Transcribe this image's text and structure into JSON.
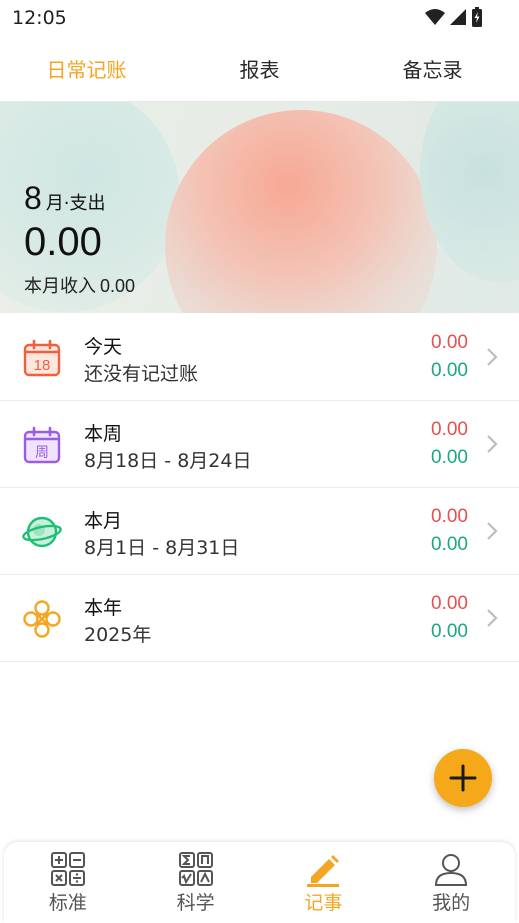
{
  "status_bar": {
    "time": "12:05"
  },
  "top_tabs": [
    {
      "label": "日常记账",
      "active": true
    },
    {
      "label": "报表",
      "active": false
    },
    {
      "label": "备忘录",
      "active": false
    }
  ],
  "banner": {
    "month_number": "8",
    "month_suffix": "月·支出",
    "expense": "0.00",
    "income_label": "本月收入",
    "income_value": "0.00"
  },
  "rows": [
    {
      "title": "今天",
      "subtitle": "还没有记过账",
      "expense": "0.00",
      "income": "0.00",
      "icon": "calendar-18-icon",
      "icon_text": "18"
    },
    {
      "title": "本周",
      "subtitle": "8月18日 - 8月24日",
      "expense": "0.00",
      "income": "0.00",
      "icon": "calendar-week-icon",
      "icon_text": "周"
    },
    {
      "title": "本月",
      "subtitle": "8月1日 - 8月31日",
      "expense": "0.00",
      "income": "0.00",
      "icon": "planet-icon"
    },
    {
      "title": "本年",
      "subtitle": "2025年",
      "expense": "0.00",
      "income": "0.00",
      "icon": "knot-icon"
    }
  ],
  "fab": {
    "icon": "plus-icon"
  },
  "bottom_nav": [
    {
      "label": "标准",
      "icon": "calculator-icon",
      "active": false
    },
    {
      "label": "科学",
      "icon": "scientific-calculator-icon",
      "active": false
    },
    {
      "label": "记事",
      "icon": "pencil-icon",
      "active": true
    },
    {
      "label": "我的",
      "icon": "person-icon",
      "active": false
    }
  ],
  "colors": {
    "accent": "#f4a623",
    "expense": "#e5504f",
    "income": "#1aa87e",
    "fab": "#f5a91a"
  }
}
